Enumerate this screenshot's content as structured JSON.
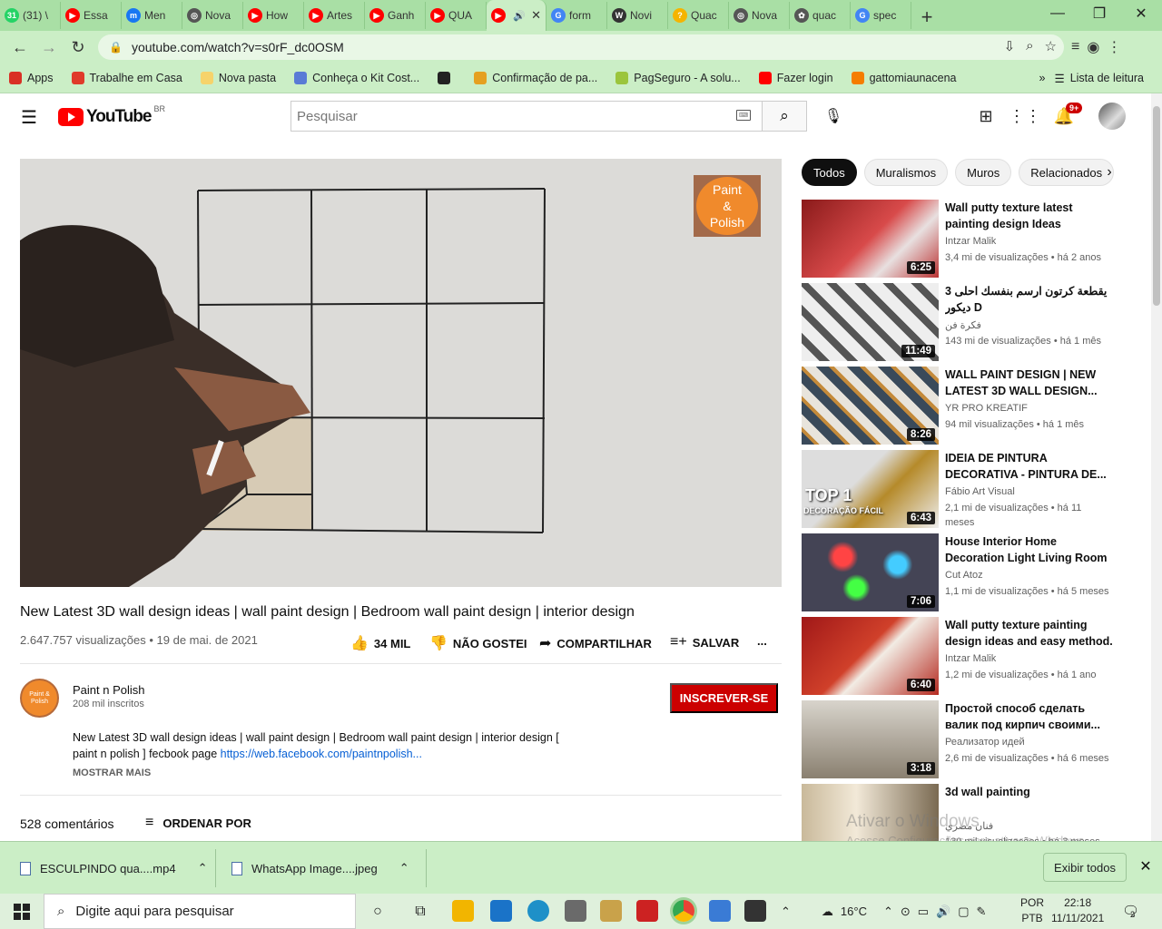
{
  "browser": {
    "tabs": [
      {
        "label": "(31) \\",
        "color": "#25d366",
        "glyph": "31"
      },
      {
        "label": "Essa",
        "color": "#ff0000",
        "glyph": "▶"
      },
      {
        "label": "Men",
        "color": "#1877f2",
        "glyph": "m"
      },
      {
        "label": "Nova",
        "color": "#555555",
        "glyph": "◎"
      },
      {
        "label": "How",
        "color": "#ff0000",
        "glyph": "▶"
      },
      {
        "label": "Artes",
        "color": "#ff0000",
        "glyph": "▶"
      },
      {
        "label": "Ganh",
        "color": "#ff0000",
        "glyph": "▶"
      },
      {
        "label": "QUA",
        "color": "#ff0000",
        "glyph": "▶"
      },
      {
        "label": "",
        "color": "#ff0000",
        "glyph": "▶",
        "active": true
      },
      {
        "label": "form",
        "color": "#4285f4",
        "glyph": "G"
      },
      {
        "label": "Novi",
        "color": "#333333",
        "glyph": "W"
      },
      {
        "label": "Quac",
        "color": "#f5b400",
        "glyph": "?"
      },
      {
        "label": "Nova",
        "color": "#555555",
        "glyph": "◎"
      },
      {
        "label": "quac",
        "color": "#555555",
        "glyph": "✿"
      },
      {
        "label": "spec",
        "color": "#4285f4",
        "glyph": "G"
      }
    ],
    "new_tab": "+",
    "minimize": "—",
    "maximize": "❐",
    "close": "✕",
    "url": "youtube.com/watch?v=s0rF_dc0OSM",
    "bookmarks": [
      {
        "label": "Apps",
        "color": "#d93025"
      },
      {
        "label": "Trabalhe em Casa",
        "color": "#e03a2a"
      },
      {
        "label": "Nova pasta",
        "color": "#f6d36b"
      },
      {
        "label": "Conheça o Kit Cost...",
        "color": "#5a7bd6"
      },
      {
        "label": "",
        "color": "#222222"
      },
      {
        "label": "Confirmação de pa...",
        "color": "#e5a021"
      },
      {
        "label": "PagSeguro - A solu...",
        "color": "#9bc53d"
      },
      {
        "label": "Fazer login",
        "color": "#ff0000"
      },
      {
        "label": "gattomiaunacena",
        "color": "#f57d00"
      }
    ],
    "bookmarks_more": "»",
    "reading_list": "Lista de leitura"
  },
  "youtube": {
    "logo_text": "YouTube",
    "logo_country": "BR",
    "search_placeholder": "Pesquisar",
    "notif_badge": "9+",
    "video": {
      "title": "New Latest 3D wall design ideas | wall paint design | Bedroom wall paint design | interior design",
      "meta": "2.647.757 visualizações • 19 de mai. de 2021",
      "likes": "34 MIL",
      "dislike": "NÃO GOSTEI",
      "share": "COMPARTILHAR",
      "save": "SALVAR",
      "more": "...",
      "watermark_lines": [
        "Paint",
        "&",
        "Polish"
      ]
    },
    "channel": {
      "name": "Paint n Polish",
      "subscribers": "208 mil inscritos",
      "subscribe": "INSCREVER-SE",
      "avatar_text": "Paint & Polish"
    },
    "description": {
      "text": "New Latest 3D wall design ideas | wall paint design | Bedroom wall paint design | interior design [ paint n polish ] fecbook page ",
      "link": "https://web.facebook.com/paintnpolish...",
      "show_more": "MOSTRAR MAIS"
    },
    "comments": {
      "count": "528 comentários",
      "sort": "ORDENAR POR"
    },
    "chips": [
      "Todos",
      "Muralismos",
      "Muros",
      "Relacionados"
    ],
    "recommendations": [
      {
        "title": "Wall putty texture latest painting design Ideas",
        "channel": "Intzar Malik",
        "views": "3,4 mi de visualizações • há 2 anos",
        "duration": "6:25",
        "bg": "linear-gradient(135deg,#8a1a1a,#d84a4a 50%,#e8e0e0 70%,#b33)"
      },
      {
        "title": "3 يقطعة كرتون ارسم بنفسك احلى ديكور D",
        "channel": "فكرة فن",
        "views": "143 mi de visualizações • há 1 mês",
        "duration": "11:49",
        "bg": "repeating-linear-gradient(45deg,#eee 0 14px,#555 14px 22px)"
      },
      {
        "title": "WALL PAINT DESIGN | NEW LATEST 3D WALL DESIGN...",
        "channel": "YR PRO KREATIF",
        "views": "94 mil visualizações • há 1 mês",
        "duration": "8:26",
        "bg": "repeating-linear-gradient(45deg,#3a4a5a 0 10px,#c48a3a 10px 14px,#e8e4dc 14px 24px)"
      },
      {
        "title": "IDEIA DE PINTURA DECORATIVA - PINTURA DE...",
        "channel": "Fábio Art Visual",
        "views": "2,1 mi de visualizações • há 11 meses",
        "duration": "6:43",
        "bg": "linear-gradient(135deg,#ddd 40%,#b58a2a 60%,#eee)",
        "overlay": "TOP 1",
        "overlay2": "DECORAÇÃO FÁCIL"
      },
      {
        "title": "House Interior Home Decoration Light Living Room Wall Light...",
        "channel": "Cut Atoz",
        "views": "1,1 mi de visualizações • há 5 meses",
        "duration": "7:06",
        "bg": "radial-gradient(circle at 30% 30%,#f44 0 8%,transparent 14%),radial-gradient(circle at 70% 40%,#4cf 0 8%,transparent 14%),radial-gradient(circle at 40% 70%,#4f4 0 8%,transparent 14%),#445"
      },
      {
        "title": "Wall putty texture painting design ideas and easy method.",
        "channel": "Intzar Malik",
        "views": "1,2 mi de visualizações • há 1 ano",
        "duration": "6:40",
        "bg": "linear-gradient(135deg,#a01818,#d0402a 45%,#f2ece4 55%,#b52a20)"
      },
      {
        "title": "Простой способ сделать валик под кирпич своими...",
        "channel": "Реализатор идей",
        "views": "2,6 mi de visualizações • há 6 meses",
        "duration": "3:18",
        "bg": "linear-gradient(180deg,#d8d4cc,#8a8070)"
      },
      {
        "title": "3d wall painting",
        "channel": "فنان مصري",
        "views": "130 mil visualizações • há 3 meses",
        "duration": "",
        "bg": "linear-gradient(90deg,#c9b99a,#f2e9d8 40%,#7a6a52)"
      }
    ]
  },
  "windows": {
    "activation_1": "Ativar o Windows",
    "activation_2": "Acesse Configurações para ativar o Windows.",
    "downloads": [
      {
        "name": "ESCULPINDO qua....mp4"
      },
      {
        "name": "WhatsApp Image....jpeg"
      }
    ],
    "show_all": "Exibir todos",
    "taskbar_search": "Digite aqui para pesquisar",
    "temperature": "16°C",
    "lang_1": "POR",
    "lang_2": "PTB",
    "time": "22:18",
    "date": "11/11/2021",
    "notif_count": "2"
  }
}
